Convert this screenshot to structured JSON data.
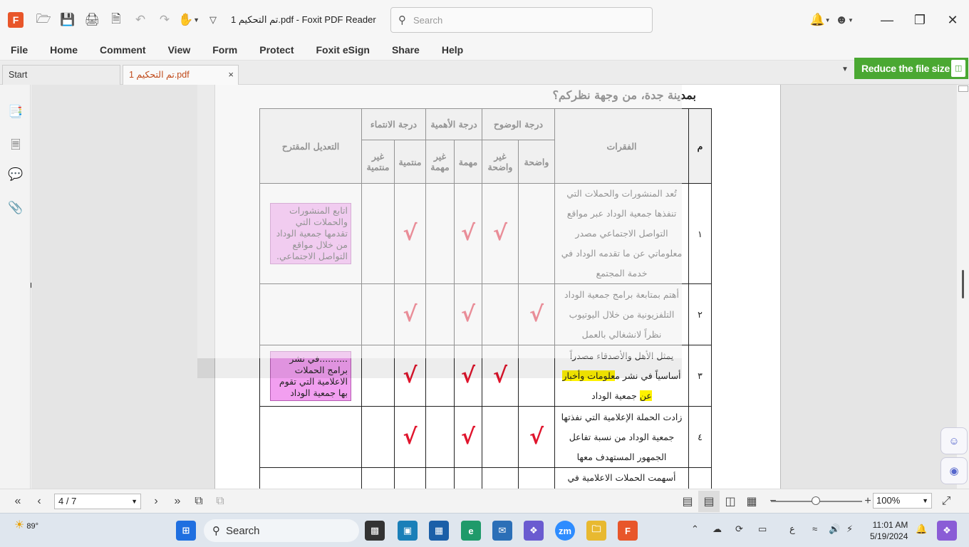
{
  "titlebar": {
    "title": "تم التحكيم 1.pdf - Foxit PDF Reader",
    "search_placeholder": "Search",
    "icons": [
      "app-logo",
      "open-folder-icon",
      "save-icon",
      "print-icon",
      "export-icon",
      "undo-icon",
      "redo-icon",
      "hand-tool-icon",
      "customize-toolbar-icon",
      "bell-icon",
      "account-icon",
      "minimize-icon",
      "restore-icon",
      "close-icon"
    ]
  },
  "menu": [
    "File",
    "Home",
    "Comment",
    "View",
    "Form",
    "Protect",
    "Foxit eSign",
    "Share",
    "Help"
  ],
  "tabs": [
    {
      "label": "Start"
    },
    {
      "label": "تم التحكيم 1.pdf",
      "close": "×"
    }
  ],
  "promo": {
    "label": "Reduce the file size"
  },
  "document": {
    "heading": "بمدينة جدة، من وجهة نظركم؟",
    "headers": {
      "num": "م",
      "items": "الفقرات",
      "clarity": "درجة الوضوح",
      "importance": "درجة الأهمية",
      "belonging": "درجة الانتماء",
      "suggestion": "التعديل المقترح",
      "clear": "واضحة",
      "not_clear": "غير واضحة",
      "important": "مهمة",
      "not_important": "غير مهمة",
      "belongs": "منتمية",
      "not_belongs": "غير منتمية"
    },
    "rows": [
      {
        "num": "١",
        "text": "تُعد المنشورات والحملات التي تنفذها جمعية الوداد عبر مواقع التواصل الاجتماعي مصدر معلوماتي عن ما تقدمه الوداد في خدمة المجتمع",
        "suggestion": "اتابع المنشورات والحملات التي تقدمها جمعية الوداد من خلال مواقع التواصل الاجتماعي."
      },
      {
        "num": "٢",
        "text": "أهتم بمتابعة برامج جمعية الوداد التلفزيونية من خلال اليوتيوب نظراً لانشغالي بالعمل",
        "suggestion": ""
      },
      {
        "num": "٣",
        "text_before": "يمثل الأهل والأصدقاء مصدراً أساسياً في نشر م",
        "text_highlight": "علومات وأخبار عن",
        "text_after": " جمعية الوداد",
        "suggestion": "..........في نشر برامج الحملات الاعلامية التي تقوم بها جمعية الوداد"
      },
      {
        "num": "٤",
        "text": "زادت الحملة الإعلامية التي نفذتها جمعية الوداد من نسبة تفاعل الجمهور المستهدف معها",
        "suggestion": ""
      },
      {
        "num": "",
        "text": "أسهمت الحملات الاعلامية في مواقع التواصل الاجتماعي الخاصة",
        "suggestion": ""
      }
    ],
    "check_mark": "√"
  },
  "statusbar": {
    "page_indicator": "4 / 7",
    "zoom": "100%"
  },
  "taskbar": {
    "weather": "89°",
    "search_label": "Search",
    "zoom_app": "zm",
    "lang": "ع",
    "time": "11:01 AM",
    "date": "5/19/2024"
  }
}
